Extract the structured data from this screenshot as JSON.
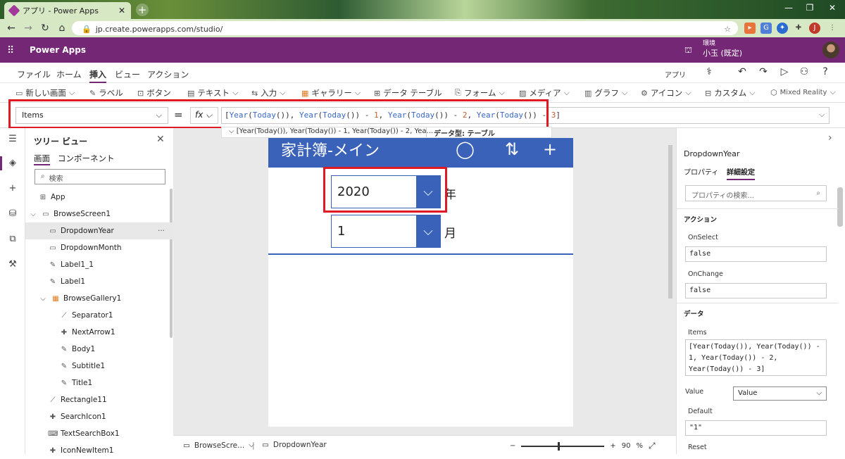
{
  "browser": {
    "tab_title": "アプリ - Power Apps",
    "url": "jp.create.powerapps.com/studio/"
  },
  "appbar": {
    "title": "Power Apps",
    "env_label": "環境",
    "env_value": "小玉 (既定)"
  },
  "menu": {
    "items": [
      "ファイル",
      "ホーム",
      "挿入",
      "ビュー",
      "アクション"
    ],
    "active": "挿入",
    "app_label": "アプリ"
  },
  "ribbon": {
    "items": [
      "新しい画面",
      "ラベル",
      "ボタン",
      "テキスト",
      "入力",
      "ギャラリー",
      "データ テーブル",
      "フォーム",
      "メディア",
      "グラフ",
      "アイコン",
      "カスタム",
      "Mixed Reality"
    ]
  },
  "formula_bar": {
    "property": "Items",
    "equals": "=",
    "fx": "fx",
    "formula_parts": [
      "[",
      "Year",
      "(",
      "Today",
      "()), ",
      "Year",
      "(",
      "Today",
      "()) - ",
      "1",
      ", ",
      "Year",
      "(",
      "Today",
      "()) - ",
      "2",
      ", ",
      "Year",
      "(",
      "Today",
      "()) - ",
      "3",
      "]"
    ],
    "intellisense": "[Year(Today()), Year(Today()) - 1, Year(Today()) - 2, Yea...",
    "data_type": "データ型: テーブル"
  },
  "tree": {
    "title": "ツリー ビュー",
    "tabs": [
      "画面",
      "コンポーネント"
    ],
    "search_placeholder": "検索",
    "items": [
      {
        "label": "App",
        "icon": "app-icon"
      },
      {
        "label": "BrowseScreen1",
        "icon": "screen-icon"
      },
      {
        "label": "DropdownYear",
        "icon": "dropdown-icon"
      },
      {
        "label": "DropdownMonth",
        "icon": "dropdown-icon"
      },
      {
        "label": "Label1_1",
        "icon": "label-icon"
      },
      {
        "label": "Label1",
        "icon": "label-icon"
      },
      {
        "label": "BrowseGallery1",
        "icon": "gallery-icon"
      },
      {
        "label": "Separator1",
        "icon": "shape-icon"
      },
      {
        "label": "NextArrow1",
        "icon": "icon-icon"
      },
      {
        "label": "Body1",
        "icon": "label-icon"
      },
      {
        "label": "Subtitle1",
        "icon": "label-icon"
      },
      {
        "label": "Title1",
        "icon": "label-icon"
      },
      {
        "label": "Rectangle11",
        "icon": "shape-icon"
      },
      {
        "label": "SearchIcon1",
        "icon": "icon-icon"
      },
      {
        "label": "TextSearchBox1",
        "icon": "textinput-icon"
      },
      {
        "label": "IconNewItem1",
        "icon": "icon-icon"
      }
    ],
    "selected": "DropdownYear",
    "more": "···"
  },
  "canvas": {
    "header_title": "家計簿-メイン",
    "year_value": "2020",
    "year_unit": "年",
    "month_value": "1",
    "month_unit": "月",
    "accent": "#3a62b8"
  },
  "bottom": {
    "screen_crumb": "BrowseScre...",
    "control_crumb": "DropdownYear",
    "zoom_minus": "−",
    "zoom_plus": "+",
    "zoom_value": "90",
    "zoom_unit": "%",
    "zoom_level": 0.45
  },
  "right_panel": {
    "control_name": "DropdownYear",
    "tabs": [
      "プロパティ",
      "詳細設定"
    ],
    "active_tab": "詳細設定",
    "search_placeholder": "プロパティの検索...",
    "section_action": "アクション",
    "onselect_label": "OnSelect",
    "onselect_value": "false",
    "onchange_label": "OnChange",
    "onchange_value": "false",
    "section_data": "データ",
    "items_label": "Items",
    "items_value": "[Year(Today()), Year(Today()) - 1, Year(Today()) - 2, Year(Today()) - 3]",
    "value_label": "Value",
    "value_select": "Value",
    "default_label": "Default",
    "default_value": "\"1\"",
    "reset_label": "Reset"
  }
}
